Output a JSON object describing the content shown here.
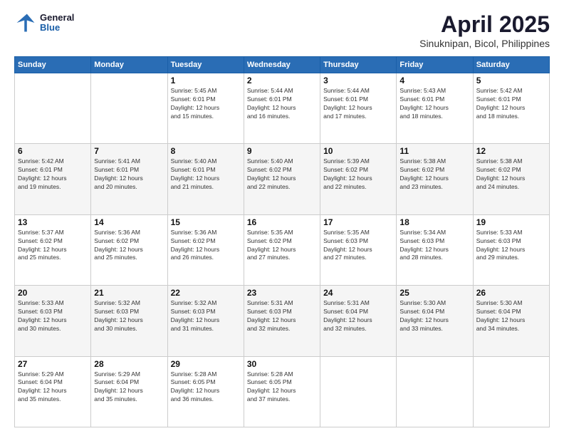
{
  "header": {
    "logo_line1": "General",
    "logo_line2": "Blue",
    "title": "April 2025",
    "subtitle": "Sinuknipan, Bicol, Philippines"
  },
  "calendar": {
    "days_of_week": [
      "Sunday",
      "Monday",
      "Tuesday",
      "Wednesday",
      "Thursday",
      "Friday",
      "Saturday"
    ],
    "weeks": [
      {
        "cells": [
          {
            "day": "",
            "info": ""
          },
          {
            "day": "",
            "info": ""
          },
          {
            "day": "1",
            "info": "Sunrise: 5:45 AM\nSunset: 6:01 PM\nDaylight: 12 hours\nand 15 minutes."
          },
          {
            "day": "2",
            "info": "Sunrise: 5:44 AM\nSunset: 6:01 PM\nDaylight: 12 hours\nand 16 minutes."
          },
          {
            "day": "3",
            "info": "Sunrise: 5:44 AM\nSunset: 6:01 PM\nDaylight: 12 hours\nand 17 minutes."
          },
          {
            "day": "4",
            "info": "Sunrise: 5:43 AM\nSunset: 6:01 PM\nDaylight: 12 hours\nand 18 minutes."
          },
          {
            "day": "5",
            "info": "Sunrise: 5:42 AM\nSunset: 6:01 PM\nDaylight: 12 hours\nand 18 minutes."
          }
        ]
      },
      {
        "cells": [
          {
            "day": "6",
            "info": "Sunrise: 5:42 AM\nSunset: 6:01 PM\nDaylight: 12 hours\nand 19 minutes."
          },
          {
            "day": "7",
            "info": "Sunrise: 5:41 AM\nSunset: 6:01 PM\nDaylight: 12 hours\nand 20 minutes."
          },
          {
            "day": "8",
            "info": "Sunrise: 5:40 AM\nSunset: 6:01 PM\nDaylight: 12 hours\nand 21 minutes."
          },
          {
            "day": "9",
            "info": "Sunrise: 5:40 AM\nSunset: 6:02 PM\nDaylight: 12 hours\nand 22 minutes."
          },
          {
            "day": "10",
            "info": "Sunrise: 5:39 AM\nSunset: 6:02 PM\nDaylight: 12 hours\nand 22 minutes."
          },
          {
            "day": "11",
            "info": "Sunrise: 5:38 AM\nSunset: 6:02 PM\nDaylight: 12 hours\nand 23 minutes."
          },
          {
            "day": "12",
            "info": "Sunrise: 5:38 AM\nSunset: 6:02 PM\nDaylight: 12 hours\nand 24 minutes."
          }
        ]
      },
      {
        "cells": [
          {
            "day": "13",
            "info": "Sunrise: 5:37 AM\nSunset: 6:02 PM\nDaylight: 12 hours\nand 25 minutes."
          },
          {
            "day": "14",
            "info": "Sunrise: 5:36 AM\nSunset: 6:02 PM\nDaylight: 12 hours\nand 25 minutes."
          },
          {
            "day": "15",
            "info": "Sunrise: 5:36 AM\nSunset: 6:02 PM\nDaylight: 12 hours\nand 26 minutes."
          },
          {
            "day": "16",
            "info": "Sunrise: 5:35 AM\nSunset: 6:02 PM\nDaylight: 12 hours\nand 27 minutes."
          },
          {
            "day": "17",
            "info": "Sunrise: 5:35 AM\nSunset: 6:03 PM\nDaylight: 12 hours\nand 27 minutes."
          },
          {
            "day": "18",
            "info": "Sunrise: 5:34 AM\nSunset: 6:03 PM\nDaylight: 12 hours\nand 28 minutes."
          },
          {
            "day": "19",
            "info": "Sunrise: 5:33 AM\nSunset: 6:03 PM\nDaylight: 12 hours\nand 29 minutes."
          }
        ]
      },
      {
        "cells": [
          {
            "day": "20",
            "info": "Sunrise: 5:33 AM\nSunset: 6:03 PM\nDaylight: 12 hours\nand 30 minutes."
          },
          {
            "day": "21",
            "info": "Sunrise: 5:32 AM\nSunset: 6:03 PM\nDaylight: 12 hours\nand 30 minutes."
          },
          {
            "day": "22",
            "info": "Sunrise: 5:32 AM\nSunset: 6:03 PM\nDaylight: 12 hours\nand 31 minutes."
          },
          {
            "day": "23",
            "info": "Sunrise: 5:31 AM\nSunset: 6:03 PM\nDaylight: 12 hours\nand 32 minutes."
          },
          {
            "day": "24",
            "info": "Sunrise: 5:31 AM\nSunset: 6:04 PM\nDaylight: 12 hours\nand 32 minutes."
          },
          {
            "day": "25",
            "info": "Sunrise: 5:30 AM\nSunset: 6:04 PM\nDaylight: 12 hours\nand 33 minutes."
          },
          {
            "day": "26",
            "info": "Sunrise: 5:30 AM\nSunset: 6:04 PM\nDaylight: 12 hours\nand 34 minutes."
          }
        ]
      },
      {
        "cells": [
          {
            "day": "27",
            "info": "Sunrise: 5:29 AM\nSunset: 6:04 PM\nDaylight: 12 hours\nand 35 minutes."
          },
          {
            "day": "28",
            "info": "Sunrise: 5:29 AM\nSunset: 6:04 PM\nDaylight: 12 hours\nand 35 minutes."
          },
          {
            "day": "29",
            "info": "Sunrise: 5:28 AM\nSunset: 6:05 PM\nDaylight: 12 hours\nand 36 minutes."
          },
          {
            "day": "30",
            "info": "Sunrise: 5:28 AM\nSunset: 6:05 PM\nDaylight: 12 hours\nand 37 minutes."
          },
          {
            "day": "",
            "info": ""
          },
          {
            "day": "",
            "info": ""
          },
          {
            "day": "",
            "info": ""
          }
        ]
      }
    ]
  }
}
